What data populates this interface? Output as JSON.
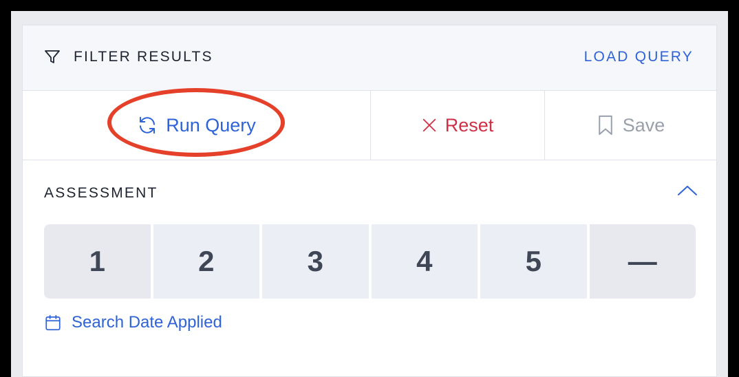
{
  "header": {
    "title": "FILTER RESULTS",
    "filter_icon": "filter-icon",
    "load_query_label": "LOAD QUERY"
  },
  "actions": {
    "run_query": {
      "label": "Run Query",
      "icon": "refresh-icon"
    },
    "reset": {
      "label": "Reset",
      "icon": "close-icon"
    },
    "save": {
      "label": "Save",
      "icon": "bookmark-icon"
    }
  },
  "assessment": {
    "title": "ASSESSMENT",
    "collapse_icon": "chevron-up-icon",
    "ratings": [
      "1",
      "2",
      "3",
      "4",
      "5",
      "—"
    ]
  },
  "search_date": {
    "label": "Search Date Applied",
    "icon": "calendar-icon"
  },
  "colors": {
    "accent": "#2e63d8",
    "danger": "#cf3045",
    "muted": "#9aa0ab",
    "annotation": "#e5402a"
  }
}
